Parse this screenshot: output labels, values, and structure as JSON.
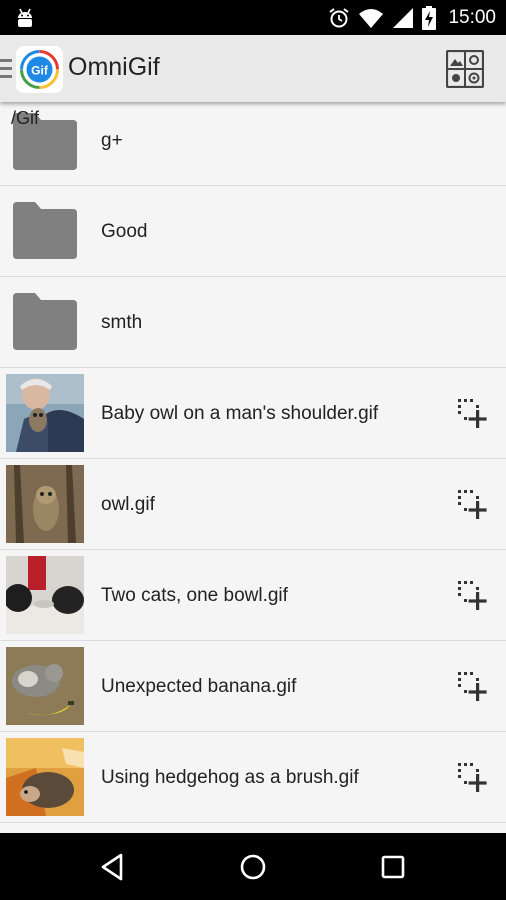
{
  "status_bar": {
    "time": "15:00",
    "icons": [
      "android-icon",
      "alarm-icon",
      "wifi-icon",
      "signal-icon",
      "battery-charging-icon"
    ]
  },
  "app_bar": {
    "title": "OmniGif",
    "logo_text": "Gif",
    "menu_icon": "hamburger-icon",
    "action_icon": "gallery-settings-icon"
  },
  "list": {
    "path": "/Gif",
    "folders": [
      {
        "name": "g+"
      },
      {
        "name": "Good"
      },
      {
        "name": "smth"
      }
    ],
    "files": [
      {
        "name": "Baby owl on a man's shoulder.gif",
        "thumb": "owl-man-thumbnail"
      },
      {
        "name": "owl.gif",
        "thumb": "owl-thumbnail"
      },
      {
        "name": "Two cats, one bowl.gif",
        "thumb": "cats-thumbnail"
      },
      {
        "name": "Unexpected banana.gif",
        "thumb": "banana-cat-thumbnail"
      },
      {
        "name": "Using hedgehog as a brush.gif",
        "thumb": "hedgehog-thumbnail"
      }
    ]
  },
  "nav_bar": {
    "back": "back-triangle-icon",
    "home": "home-circle-icon",
    "recents": "recents-square-icon"
  },
  "colors": {
    "status_bar": "#000000",
    "app_bar": "#e9e9e9",
    "list_bg": "#f5f5f5",
    "folder": "#808080",
    "icon_dark": "#333333"
  }
}
